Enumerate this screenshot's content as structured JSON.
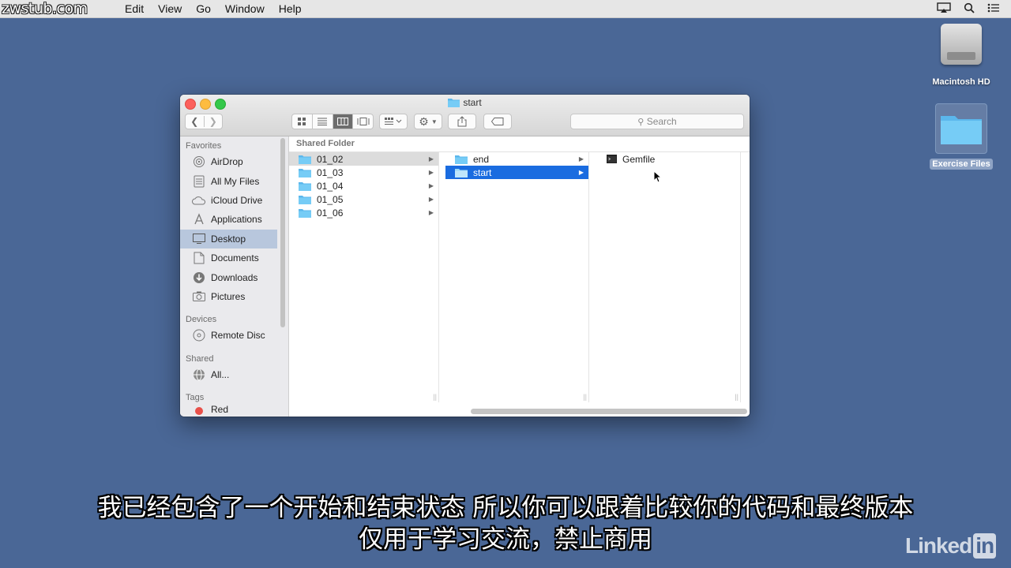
{
  "watermark": "zwstub.com",
  "menubar": {
    "items": [
      "Edit",
      "View",
      "Go",
      "Window",
      "Help"
    ]
  },
  "desktop": {
    "hd_label": "Macintosh HD",
    "folder_label": "Exercise Files"
  },
  "window": {
    "title": "start",
    "search_placeholder": "Search"
  },
  "sidebar": {
    "favorites_header": "Favorites",
    "favorites": [
      {
        "label": "AirDrop",
        "icon": "airdrop-icon"
      },
      {
        "label": "All My Files",
        "icon": "all-files-icon"
      },
      {
        "label": "iCloud Drive",
        "icon": "cloud-icon"
      },
      {
        "label": "Applications",
        "icon": "applications-icon"
      },
      {
        "label": "Desktop",
        "icon": "desktop-icon"
      },
      {
        "label": "Documents",
        "icon": "documents-icon"
      },
      {
        "label": "Downloads",
        "icon": "downloads-icon"
      },
      {
        "label": "Pictures",
        "icon": "camera-icon"
      }
    ],
    "selected": "Desktop",
    "devices_header": "Devices",
    "devices": [
      {
        "label": "Remote Disc",
        "icon": "disc-icon"
      }
    ],
    "shared_header": "Shared",
    "shared": [
      {
        "label": "All...",
        "icon": "network-icon"
      }
    ],
    "tags_header": "Tags",
    "tags": [
      {
        "label": "Red",
        "color": "#e8504a"
      }
    ]
  },
  "browser": {
    "path_label": "Shared Folder",
    "column1": [
      "01_02",
      "01_03",
      "01_04",
      "01_05",
      "01_06"
    ],
    "column2": [
      "end",
      "start"
    ],
    "column3": [
      "Gemfile"
    ]
  },
  "subtitles": {
    "line1": "我已经包含了一个开始和结束状态 所以你可以跟着比较你的代码和最终版本",
    "line2": "仅用于学习交流，禁止商用"
  },
  "branding": {
    "linked": "Linked",
    "in": "in"
  },
  "colors": {
    "desktop": "#4a6796",
    "selection_blue": "#1a6ce0",
    "folder": "#6cc4f3"
  }
}
